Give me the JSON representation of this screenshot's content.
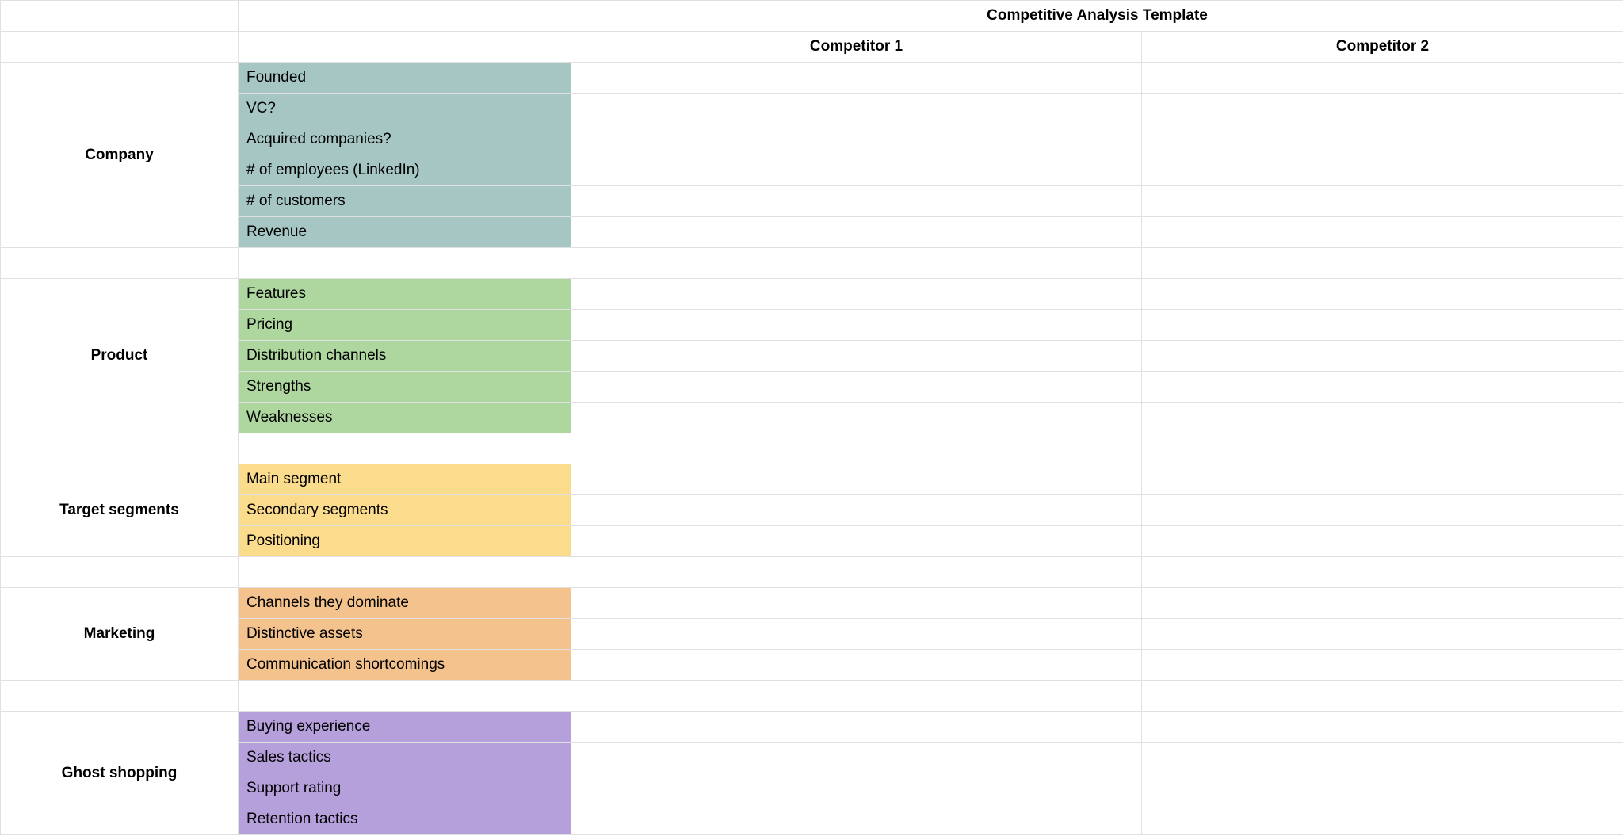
{
  "title": "Competitive Analysis Template",
  "headers": {
    "competitor1": "Competitor 1",
    "competitor2": "Competitor 2"
  },
  "sections": [
    {
      "name": "Company",
      "color": "c-teal",
      "rows": [
        "Founded",
        "VC?",
        "Acquired companies?",
        "# of employees (LinkedIn)",
        "# of customers",
        "Revenue"
      ]
    },
    {
      "name": "Product",
      "color": "c-green",
      "rows": [
        "Features",
        "Pricing",
        "Distribution channels",
        "Strengths",
        "Weaknesses"
      ]
    },
    {
      "name": "Target segments",
      "color": "c-yellow",
      "rows": [
        "Main segment",
        "Secondary segments",
        "Positioning"
      ]
    },
    {
      "name": "Marketing",
      "color": "c-orange",
      "rows": [
        "Channels they dominate",
        "Distinctive assets",
        "Communication shortcomings"
      ]
    },
    {
      "name": "Ghost shopping",
      "color": "c-purple",
      "rows": [
        "Buying experience",
        "Sales tactics",
        "Support rating",
        "Retention tactics"
      ]
    }
  ]
}
